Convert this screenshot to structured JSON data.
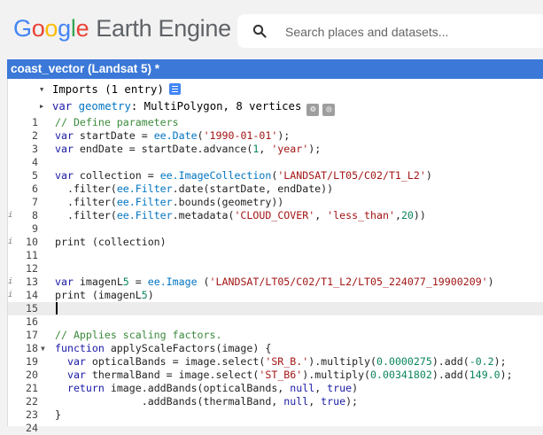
{
  "app": {
    "logo_google": [
      "G",
      "o",
      "o",
      "g",
      "l",
      "e"
    ],
    "product": "Earth Engine"
  },
  "search": {
    "placeholder": "Search places and datasets..."
  },
  "tab": {
    "title": "coast_vector (Landsat 5) *"
  },
  "imports": {
    "header": "Imports (1 entry)",
    "var_keyword": "var",
    "var_name": "geometry",
    "var_desc": ": MultiPolygon, 8 vertices"
  },
  "editor": {
    "active_line": 15,
    "lines": [
      {
        "n": "1",
        "t": "// Define parameters"
      },
      {
        "n": "2",
        "t": "var startDate = ee.Date('1990-01-01');"
      },
      {
        "n": "3",
        "t": "var endDate = startDate.advance(1, 'year');"
      },
      {
        "n": "4",
        "t": ""
      },
      {
        "n": "5",
        "t": "var collection = ee.ImageCollection('LANDSAT/LT05/C02/T1_L2')"
      },
      {
        "n": "6",
        "t": "  .filter(ee.Filter.date(startDate, endDate))"
      },
      {
        "n": "7",
        "t": "  .filter(ee.Filter.bounds(geometry))"
      },
      {
        "n": "8",
        "t": "  .filter(ee.Filter.metadata('CLOUD_COVER', 'less_than',20))"
      },
      {
        "n": "9",
        "t": ""
      },
      {
        "n": "10",
        "t": "print (collection)"
      },
      {
        "n": "11",
        "t": ""
      },
      {
        "n": "12",
        "t": ""
      },
      {
        "n": "13",
        "t": "var imagenL5 = ee.Image ('LANDSAT/LT05/C02/T1_L2/LT05_224077_19900209')"
      },
      {
        "n": "14",
        "t": "print (imagenL5)"
      },
      {
        "n": "15",
        "t": ""
      },
      {
        "n": "16",
        "t": ""
      },
      {
        "n": "17",
        "t": "// Applies scaling factors."
      },
      {
        "n": "18",
        "t": "function applyScaleFactors(image) {"
      },
      {
        "n": "19",
        "t": "  var opticalBands = image.select('SR_B.').multiply(0.0000275).add(-0.2);"
      },
      {
        "n": "20",
        "t": "  var thermalBand = image.select('ST_B6').multiply(0.00341802).add(149.0);"
      },
      {
        "n": "21",
        "t": "  return image.addBands(opticalBands, null, true)"
      },
      {
        "n": "22",
        "t": "              .addBands(thermalBand, null, true);"
      },
      {
        "n": "23",
        "t": "}"
      },
      {
        "n": "24",
        "t": ""
      }
    ]
  }
}
